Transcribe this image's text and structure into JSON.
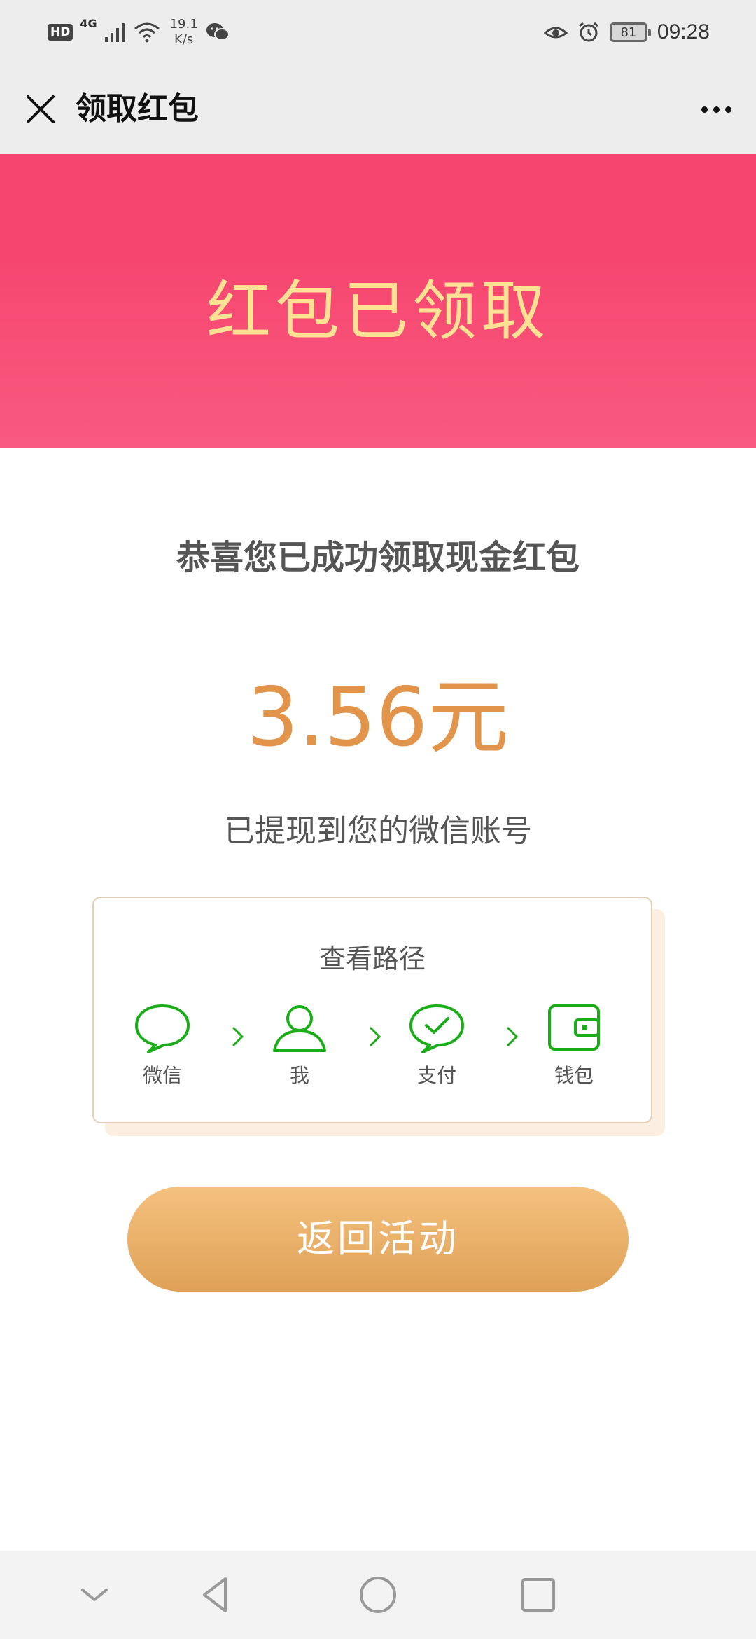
{
  "status_bar": {
    "hd": "HD",
    "network": "4G",
    "speed_value": "19.1",
    "speed_unit": "K/s",
    "battery": "81",
    "time": "09:28"
  },
  "title_bar": {
    "title": "领取红包",
    "close_icon": "close-icon",
    "more_icon": "more-icon"
  },
  "banner": {
    "title": "红包已领取"
  },
  "main": {
    "congrats": "恭喜您已成功领取现金红包",
    "amount": "3.56元",
    "subtext": "已提现到您的微信账号"
  },
  "path_card": {
    "title": "查看路径",
    "steps": [
      {
        "label": "微信",
        "icon": "chat-bubble-icon"
      },
      {
        "label": "我",
        "icon": "user-icon"
      },
      {
        "label": "支付",
        "icon": "payment-check-icon"
      },
      {
        "label": "钱包",
        "icon": "wallet-icon"
      }
    ]
  },
  "return_button": {
    "label": "返回活动"
  },
  "colors": {
    "banner": "#f64670",
    "banner_title": "#ffe194",
    "amount": "#e2944b",
    "icon_green": "#1aad19",
    "button_top": "#f4c17e",
    "button_bottom": "#dfa157"
  },
  "nav_bar": {
    "icons": [
      "collapse-icon",
      "back-icon",
      "home-icon",
      "recents-icon"
    ]
  }
}
